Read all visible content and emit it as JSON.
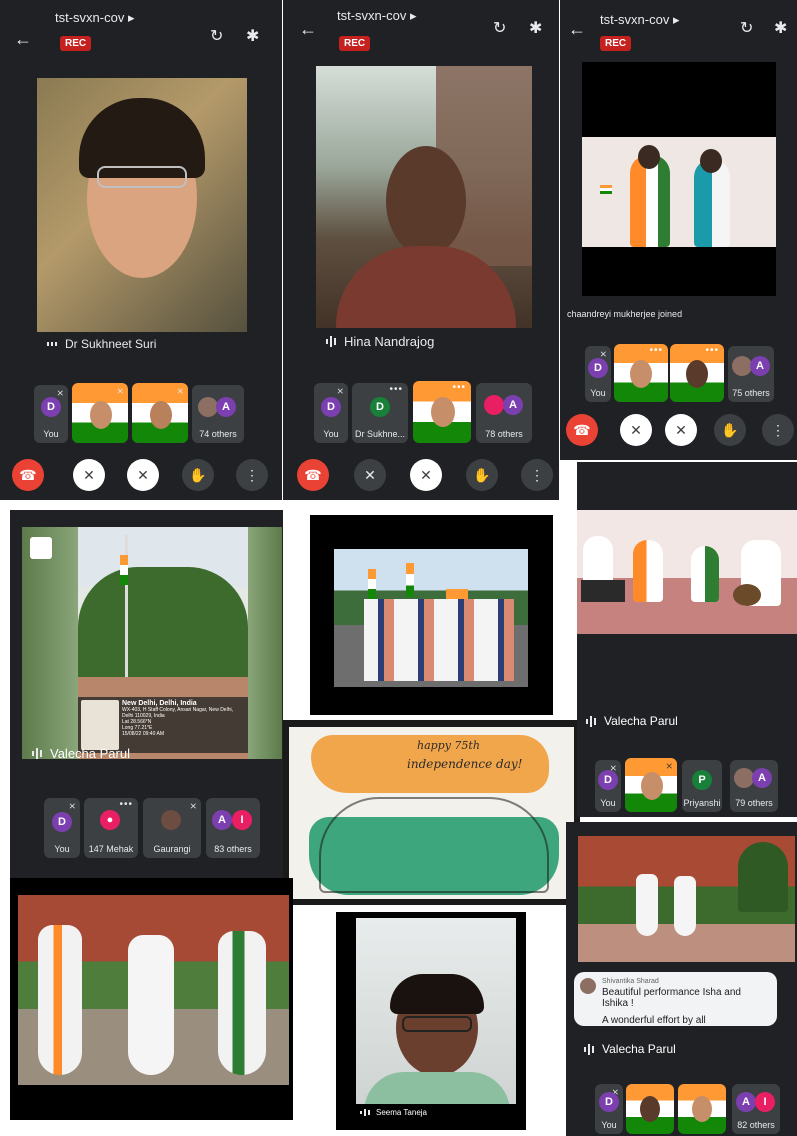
{
  "colors": {
    "end_call": "#ea4335",
    "rec": "#c5221f",
    "surface": "#202124",
    "tile": "#3c4043"
  },
  "screens": [
    {
      "title": "tst-svxn-cov ▸",
      "rec": "REC",
      "back_icon": "←",
      "rotate_icon": "↻",
      "bt_icon": "✱"
    },
    {
      "title": "tst-svxn-cov ▸",
      "rec": "REC",
      "back_icon": "←",
      "rotate_icon": "↻",
      "bt_icon": "✱"
    },
    {
      "title": "tst-svxn-cov ▸",
      "rec": "REC",
      "back_icon": "←",
      "rotate_icon": "↻",
      "bt_icon": "✱"
    }
  ],
  "speakers": {
    "s1": "Dr Sukhneet Suri",
    "s2": "Hina Nandrajog",
    "s3": "Valecha Parul",
    "s4": "Valecha Parul",
    "s5": "Seema Taneja",
    "s6": "Valecha Parul"
  },
  "join_notice": "chaandreyi mukherjee joined",
  "strip1": {
    "you_av": "D",
    "you": "You",
    "others_av": "A",
    "others": "74 others"
  },
  "strip2": {
    "you_av": "D",
    "you": "You",
    "d_av": "D",
    "d_name": "Dr Sukhne...",
    "others_av": "A",
    "others": "78 others"
  },
  "strip3": {
    "you_av": "D",
    "you": "You",
    "others_av": "A",
    "others": "75 others"
  },
  "strip4": {
    "you_av": "D",
    "you": "You",
    "m_name": "147 Mehak",
    "g_name": "Gaurangi",
    "others_av1": "A",
    "others_av2": "I",
    "others": "83 others"
  },
  "strip5": {
    "you_av": "D",
    "you": "You",
    "p_av": "P",
    "p_name": "Priyanshi",
    "others_av": "A",
    "others": "79 others"
  },
  "strip6": {
    "you_av": "D",
    "you": "You",
    "others_av1": "A",
    "others_av2": "I",
    "others": "82 others"
  },
  "controls": {
    "end_icon": "☎",
    "cam_icon": "✕",
    "mic_icon": "✕",
    "hand_icon": "✋",
    "more_icon": "⋮"
  },
  "location_card": {
    "place": "New Delhi, Delhi, India",
    "addr": "WX-403, H Staff Colony, Ansari Nagar, New Delhi, Delhi 110029, India",
    "lat": "Lat 28.566*N",
    "long": "Long 77.21*E",
    "time": "15/08/22 09:40 AM"
  },
  "art_text": {
    "line1": "happy 75th",
    "line2": "independence day!"
  },
  "chat": {
    "sender": "Shivantika Sharad",
    "msg1": "Beautiful performance Isha and Ishika !",
    "msg2": "A wonderful effort by all"
  }
}
